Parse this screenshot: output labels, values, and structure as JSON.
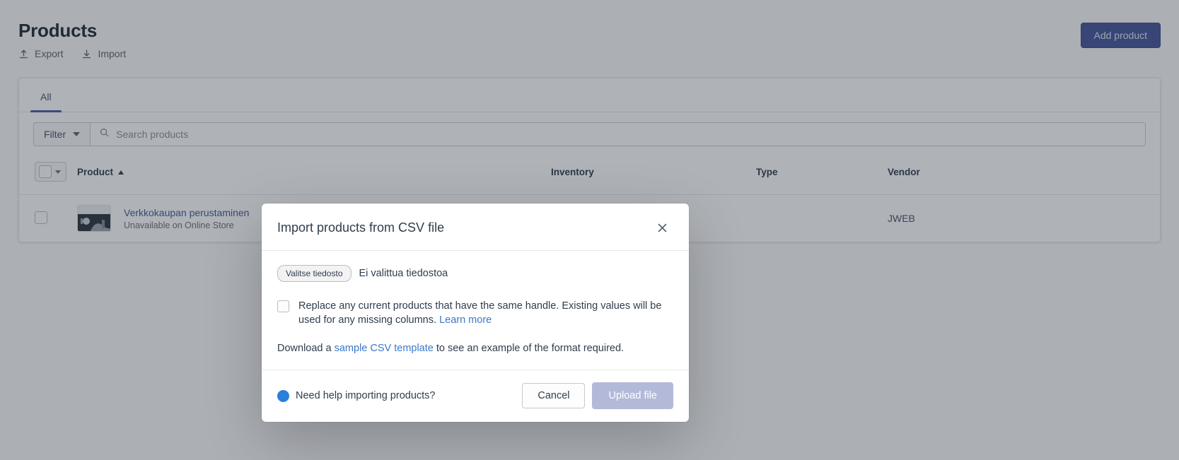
{
  "page": {
    "title": "Products",
    "actions": [
      {
        "label": "Export",
        "icon": "upload-arrow-icon"
      },
      {
        "label": "Import",
        "icon": "download-arrow-icon"
      }
    ],
    "add_product_label": "Add product"
  },
  "card": {
    "tabs": [
      {
        "label": "All",
        "active": true
      }
    ],
    "filter": {
      "label": "Filter",
      "icon": "chevron-down-icon"
    },
    "search": {
      "placeholder": "Search products",
      "value": "",
      "icon": "search-icon"
    },
    "table": {
      "columns": [
        "Product",
        "Inventory",
        "Type",
        "Vendor"
      ],
      "sort_column": "Product",
      "sort_direction": "ascending",
      "rows": [
        {
          "name": "Verkkokaupan perustaminen",
          "status": "Unavailable on Online Store",
          "inventory": "",
          "type": "",
          "vendor": "JWEB"
        }
      ]
    }
  },
  "modal": {
    "title": "Import products from CSV file",
    "close_icon": "close-icon",
    "file_input": {
      "button_label": "Valitse tiedosto",
      "status_text": "Ei valittua tiedostoa"
    },
    "replace_checkbox": {
      "checked": false,
      "text": "Replace any current products that have the same handle. Existing values will be used for any missing columns.",
      "link_label": "Learn more"
    },
    "download_line": {
      "prefix": "Download a ",
      "link_label": "sample CSV template",
      "suffix": " to see an example of the format required."
    },
    "footer": {
      "help_label": "Need help importing products?",
      "cancel_label": "Cancel",
      "upload_label": "Upload file",
      "upload_disabled": true
    }
  },
  "colors": {
    "accent": "#44549a",
    "link": "#3b78c8",
    "tab_underline": "#4959a0",
    "help_dot": "#2a7fdb",
    "upload_disabled": "#b3bad9"
  }
}
